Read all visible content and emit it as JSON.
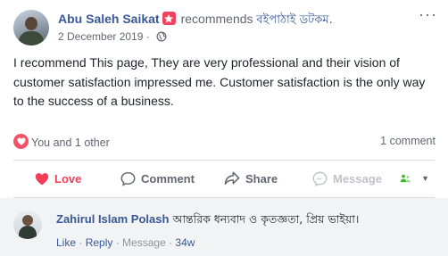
{
  "post": {
    "author": "Abu Saleh Saikat",
    "action_text": "recommends",
    "page_name": "বইপাঠাই ডটকম.",
    "date": "2 December 2019",
    "date_separator": " · ",
    "privacy_icon": "globe-icon",
    "more_icon": "more-options-icon",
    "body": "I recommend This page, They are very professional and their vision of customer satisfaction impressed me. Customer satisfaction is the only way to the success of a business."
  },
  "reactions": {
    "icon": "love-reaction-icon",
    "summary": "You and 1 other",
    "comment_count": "1 comment"
  },
  "actions": {
    "love": "Love",
    "comment": "Comment",
    "share": "Share",
    "message": "Message"
  },
  "comment": {
    "author": "Zahirul Islam Polash",
    "text": "আন্তরিক ধন্যবাদ ও কৃতজ্ঞতা, প্রিয় ভাইয়া।",
    "like": "Like",
    "reply": "Reply",
    "message": "Message",
    "time": "34w",
    "separator": " · "
  },
  "colors": {
    "link_blue": "#385898",
    "love_red": "#f33e58",
    "badge_pink": "#f3425f",
    "comment_bg": "#f2f3f5"
  }
}
